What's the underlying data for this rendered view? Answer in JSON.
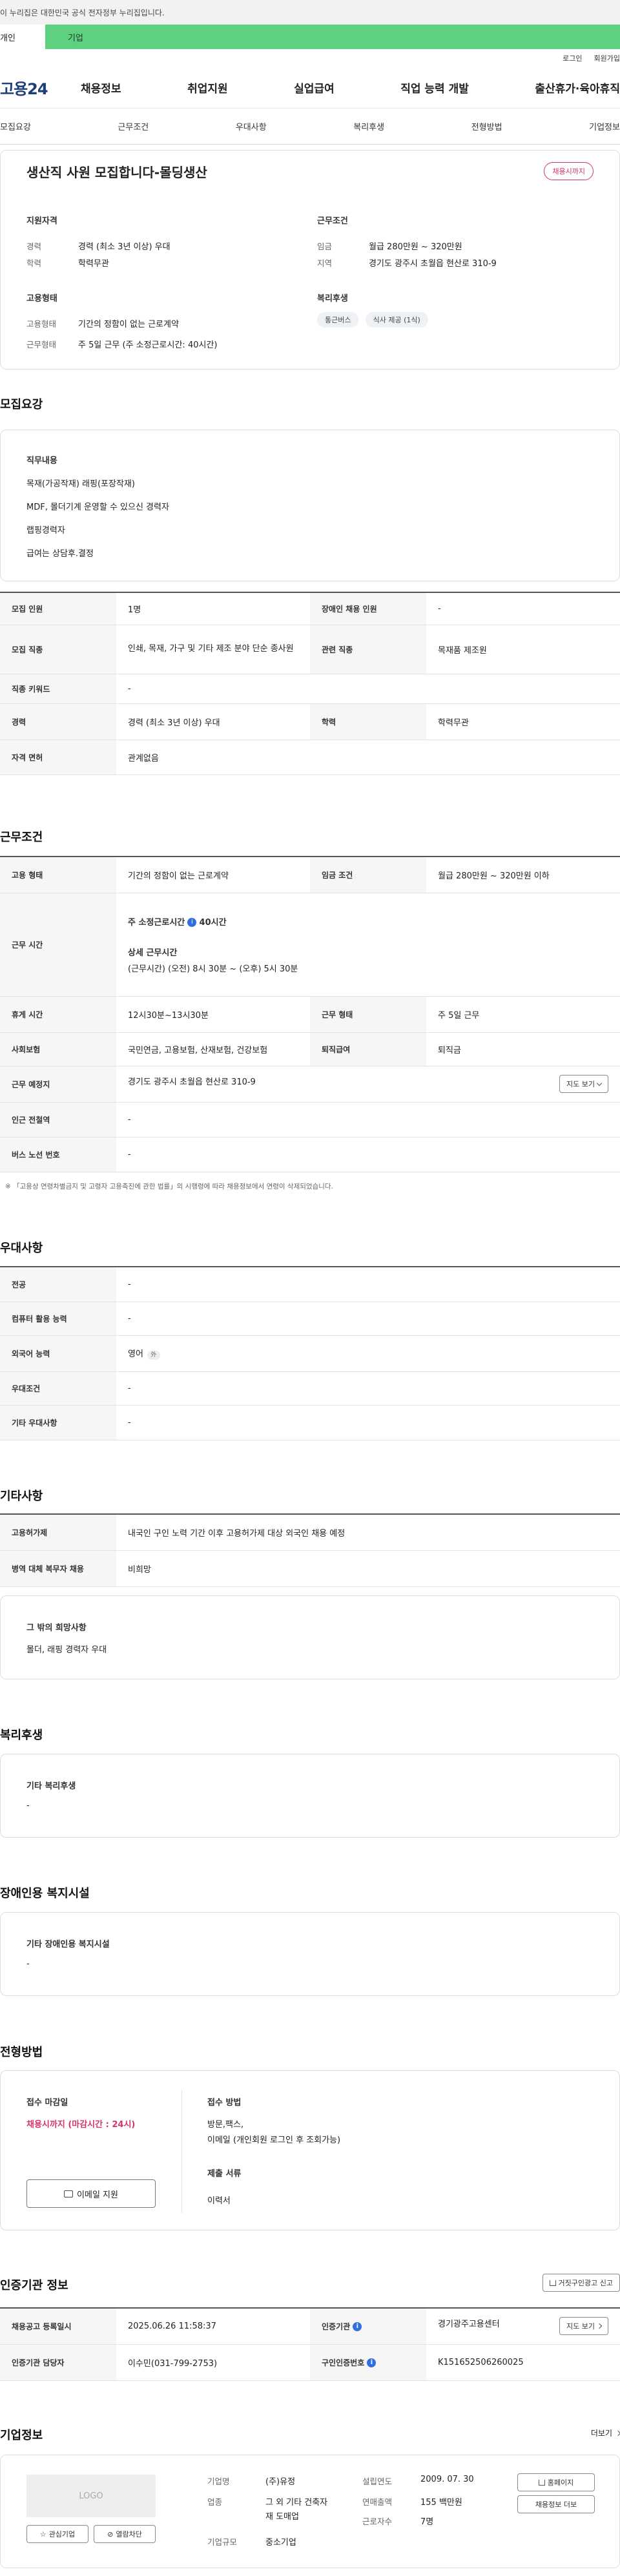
{
  "gov_bar": {
    "text": "이 누리집은 대한민국 공식 전자정부 누리집입니다."
  },
  "tabs": [
    {
      "label": "개인"
    },
    {
      "label": "기업"
    }
  ],
  "util": {
    "login": "로그인",
    "join": "회원가입"
  },
  "gnb": {
    "logo": "고용24",
    "menu": [
      "채용정보",
      "취업지원",
      "실업급여",
      "직업 능력 개발",
      "출산휴가·육아휴직"
    ]
  },
  "subnav": [
    "모집요강",
    "근무조건",
    "우대사항",
    "복리후생",
    "전형방법",
    "기업정보"
  ],
  "job": {
    "title": "생산직 사원 모집합니다-몰딩생산",
    "badge": "채용시까지",
    "qual_title": "지원자격",
    "career_k": "경력",
    "career_v": "경력 (최소 3년 이상) 우대",
    "edu_k": "학력",
    "edu_v": "학력무관",
    "cond_title": "근무조건",
    "wage_k": "임금",
    "wage_v": "월급 280만원 ~ 320만원",
    "region_k": "지역",
    "region_v": "경기도 광주시 초월읍 현산로 310-9",
    "emp_title": "고용형태",
    "emp_k": "고용형태",
    "emp_v": "기간의 정함이 없는 근로계약",
    "work_k": "근무형태",
    "work_v": "주 5일 근무 (주 소정근로시간: 40시간)",
    "welfare_title": "복리후생",
    "chips": [
      "통근버스",
      "식사 제공 (1식)"
    ]
  },
  "recruit": {
    "heading": "모집요강",
    "duty_title": "직무내용",
    "duty_lines": [
      "목재(가공작재) 래핑(포장작재)",
      "MDF, 몰더기계 운영할 수 있으신 경력자",
      "랩핑경력자",
      "급여는 상담후.결정"
    ],
    "rows": [
      {
        "k1": "모집 인원",
        "v1": "1명",
        "k2": "장애인 채용 인원",
        "v2": "-"
      },
      {
        "k1": "모집 직종",
        "v1": "인쇄, 목재, 가구 및 기타 제조 분야 단순 종사원",
        "k2": "관련 직종",
        "v2": "목재품 제조원"
      },
      {
        "k1": "직종 키워드",
        "v1": "-"
      },
      {
        "k1": "경력",
        "v1": "경력 (최소 3년 이상) 우대",
        "k2": "학력",
        "v2": "학력무관"
      },
      {
        "k1": "자격 면허",
        "v1": "관계없음"
      }
    ]
  },
  "work": {
    "heading": "근무조건",
    "emp_k": "고용 형태",
    "emp_v": "기간의 정함이 없는 근로계약",
    "wage_k": "임금 조건",
    "wage_v": "월급 280만원 ~ 320만원 이하",
    "time_k": "근무 시간",
    "time_weekly": "주 소정근로시간",
    "time_hours": "40시간",
    "time_detail_t": "상세 근무시간",
    "time_detail_v": "(근무시간) (오전) 8시 30분 ~ (오후) 5시 30분",
    "break_k": "휴게 시간",
    "break_v": "12시30분~13시30분",
    "type_k": "근무 형태",
    "type_v": "주 5일 근무",
    "ins_k": "사회보험",
    "ins_v": "국민연금, 고용보험, 산재보험, 건강보험",
    "ret_k": "퇴직급여",
    "ret_v": "퇴직금",
    "loc_k": "근무 예정지",
    "loc_v": "경기도 광주시 초월읍 현산로 310-9",
    "map_btn": "지도 보기",
    "sub_k": "인근 전철역",
    "sub_v": "-",
    "bus_k": "버스 노선 번호",
    "bus_v": "-",
    "note": "※ 「고용상 연령차별금지 및 고령자 고용촉진에 관한 법률」의 시행령에 따라 채용정보에서 연령이 삭제되었습니다."
  },
  "pref": {
    "heading": "우대사항",
    "rows": [
      {
        "k": "전공",
        "v": "-"
      },
      {
        "k": "컴퓨터 활용 능력",
        "v": "-"
      },
      {
        "k": "외국어 능력",
        "v": "영어",
        "tag": "外"
      },
      {
        "k": "우대조건",
        "v": "-"
      },
      {
        "k": "기타 우대사항",
        "v": "-"
      }
    ]
  },
  "etc": {
    "heading": "기타사항",
    "rows": [
      {
        "k": "고용허가제",
        "v": "내국인 구인 노력 기간 이후 고용허가제 대상 외국인 채용 예정"
      },
      {
        "k": "병역 대체 복무자 채용",
        "v": "비희망"
      }
    ],
    "box_title": "그 밖의 희망사항",
    "box_value": "몰더, 래핑 경력자 우대"
  },
  "welfare": {
    "heading": "복리후생",
    "box_title": "기타 복리후생",
    "box_value": "-"
  },
  "disabled": {
    "heading": "장애인용 복지시설",
    "box_title": "기타 장애인용 복지시설",
    "box_value": "-"
  },
  "apply": {
    "heading": "전형방법",
    "deadline_t": "접수 마감일",
    "deadline_v": "채용시까지 (마감시간 : 24시)",
    "email_btn": "이메일 지원",
    "method_t": "접수 방법",
    "method_v1": "방문,팩스,",
    "method_v2": "이메일 (개인회원 로그인 후 조회가능)",
    "doc_t": "제출 서류",
    "doc_v": "이력서"
  },
  "cert": {
    "heading": "인증기관 정보",
    "report_btn": "거짓구인광고 신고",
    "reg_k": "채용공고 등록일시",
    "reg_v": "2025.06.26 11:58:37",
    "org_k": "인증기관",
    "org_v": "경기광주고용센터",
    "map_btn": "지도 보기",
    "mgr_k": "인증기관 담당자",
    "mgr_v": "이수민(031-799-2753)",
    "no_k": "구인인증번호",
    "no_v": "K151652506260025"
  },
  "company": {
    "heading": "기업정보",
    "more": "더보기",
    "logo": "LOGO",
    "fav_btn": "관심기업",
    "block_btn": "열람차단",
    "name_k": "기업명",
    "name_v": "(주)유정",
    "est_k": "설립연도",
    "est_v": "2009. 07. 30",
    "home_btn": "홈페이지",
    "ind_k": "업종",
    "ind_v1": "그 외 기타 건축자",
    "ind_v2": "재 도매업",
    "rev_k": "연매출액",
    "rev_v": "155 백만원",
    "recruit_btn": "채용정보 더보",
    "emp_k": "근로자수",
    "emp_v": "7명",
    "size_k": "기업규모",
    "size_v": "중소기업"
  },
  "colors": {
    "green": "#5fcf80",
    "red": "#d6336c",
    "navy": "#1f3f7a",
    "blue": "#2f6fe0"
  }
}
